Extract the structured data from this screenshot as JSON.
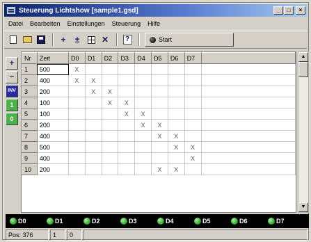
{
  "window": {
    "title": "Steuerung Lichtshow [sample1.gsd]",
    "buttons": [
      "_",
      "□",
      "×"
    ]
  },
  "menu": [
    "Datei",
    "Bearbeiten",
    "Einstellungen",
    "Steuerung",
    "Hilfe"
  ],
  "toolbar": {
    "icons": [
      "new-icon",
      "open-icon",
      "save-icon",
      "add-icon",
      "insert-icon",
      "grid-icon",
      "delete-icon",
      "help-icon"
    ],
    "start_label": "Start"
  },
  "side_buttons": [
    "+",
    "−",
    "INV",
    "1",
    "0"
  ],
  "table": {
    "columns": [
      "Nr",
      "Zeit",
      "D0",
      "D1",
      "D2",
      "D3",
      "D4",
      "D5",
      "D6",
      "D7"
    ],
    "rows": [
      {
        "nr": "1",
        "time": "500",
        "marks": [
          "X",
          "",
          "",
          "",
          "",
          "",
          "",
          ""
        ]
      },
      {
        "nr": "2",
        "time": "400",
        "marks": [
          "X",
          "X",
          "",
          "",
          "",
          "",
          "",
          ""
        ]
      },
      {
        "nr": "3",
        "time": "200",
        "marks": [
          "",
          "X",
          "X",
          "",
          "",
          "",
          "",
          ""
        ]
      },
      {
        "nr": "4",
        "time": "100",
        "marks": [
          "",
          "",
          "X",
          "X",
          "",
          "",
          "",
          ""
        ]
      },
      {
        "nr": "5",
        "time": "100",
        "marks": [
          "",
          "",
          "",
          "X",
          "X",
          "",
          "",
          ""
        ]
      },
      {
        "nr": "6",
        "time": "200",
        "marks": [
          "",
          "",
          "",
          "",
          "X",
          "X",
          "",
          ""
        ]
      },
      {
        "nr": "7",
        "time": "400",
        "marks": [
          "",
          "",
          "",
          "",
          "",
          "X",
          "X",
          ""
        ]
      },
      {
        "nr": "8",
        "time": "500",
        "marks": [
          "",
          "",
          "",
          "",
          "",
          "",
          "X",
          "X"
        ]
      },
      {
        "nr": "9",
        "time": "400",
        "marks": [
          "",
          "",
          "",
          "",
          "",
          "",
          "",
          "X"
        ]
      },
      {
        "nr": "10",
        "time": "200",
        "marks": [
          "",
          "",
          "",
          "",
          "",
          "X",
          "X",
          ""
        ]
      }
    ]
  },
  "leds": [
    "D0",
    "D1",
    "D2",
    "D3",
    "D4",
    "D5",
    "D6",
    "D7"
  ],
  "status": {
    "position_label": "Pos: 376",
    "line": "1",
    "col": "0"
  },
  "colors": {
    "title_bar": "#0a246a",
    "led_on": "#2fa52f",
    "led_bar": "#000000"
  }
}
